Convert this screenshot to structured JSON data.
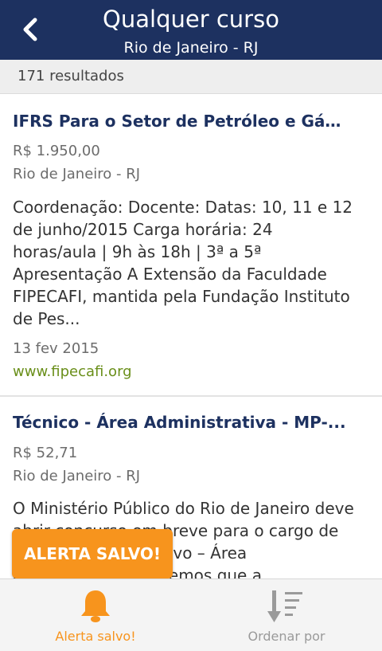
{
  "header": {
    "back_icon": "chevron-left-icon",
    "title": "Qualquer curso",
    "subtitle": "Rio de Janeiro - RJ"
  },
  "results": {
    "count_text": "171 resultados"
  },
  "courses": [
    {
      "title": "IFRS Para o Setor de Petróleo e Gás ...",
      "price": "R$ 1.950,00",
      "location": "Rio de Janeiro - RJ",
      "description": "Coordenação: Docente: Datas: 10, 11 e 12 de junho/2015 Carga horária: 24 horas/aula | 9h às 18h | 3ª a 5ª Apresentação A Extensão da Faculdade FIPECAFI, mantida pela Fundação Instituto de Pes...",
      "date": "13 fev 2015",
      "site": "www.fipecafi.org"
    },
    {
      "title": "Técnico - Área Administrativa - MP-...",
      "price": "R$ 52,71",
      "location": "Rio de Janeiro - RJ",
      "description": "O Ministério Público do Rio de Janeiro deve abrir concurso em breve para o cargo de Técnico Administrativo – Área Administrativa. Sabemos que a"
    }
  ],
  "toast": {
    "text": "ALERTA SALVO!"
  },
  "bottom_bar": {
    "alert": {
      "label": "Alerta salvo!",
      "icon": "bell-icon"
    },
    "order": {
      "label": "Ordenar por",
      "icon": "sort-icon"
    }
  },
  "colors": {
    "header": "#1d3160",
    "accent": "#f7941d",
    "link": "#6a8f1a"
  }
}
